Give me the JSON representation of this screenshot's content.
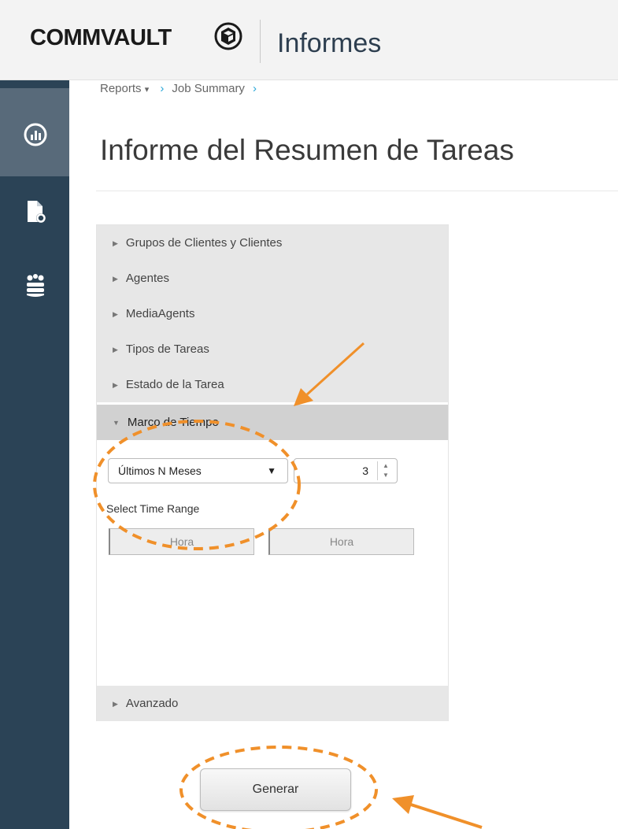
{
  "header": {
    "logo_text": "COMMVAULT",
    "app_title": "Informes"
  },
  "sidebar": {
    "items": [
      {
        "icon": "reports-icon",
        "active": true
      },
      {
        "icon": "document-settings-icon",
        "active": false
      },
      {
        "icon": "team-stack-icon",
        "active": false
      }
    ]
  },
  "breadcrumb": {
    "items": [
      "Reports",
      "Job Summary"
    ]
  },
  "page": {
    "title": "Informe del Resumen de Tareas"
  },
  "filters": {
    "sections": [
      {
        "label": "Grupos de Clientes y Clientes",
        "expanded": false
      },
      {
        "label": "Agentes",
        "expanded": false
      },
      {
        "label": "MediaAgents",
        "expanded": false
      },
      {
        "label": "Tipos de Tareas",
        "expanded": false
      },
      {
        "label": "Estado de la Tarea",
        "expanded": false
      },
      {
        "label": "Marco de Tiempo",
        "expanded": true
      }
    ],
    "timeframe": {
      "selected_option": "Últimos N Meses",
      "count_value": "3",
      "range_label": "Select Time Range",
      "start_button": "Hora",
      "end_button": "Hora"
    },
    "advanced_label": "Avanzado"
  },
  "actions": {
    "generate_label": "Generar"
  },
  "annotation_color": "#f0902a",
  "colors": {
    "sidebar": "#2b4356",
    "sidebar_active": "#586a7a",
    "breadcrumb_chevron": "#2aa7d8"
  }
}
